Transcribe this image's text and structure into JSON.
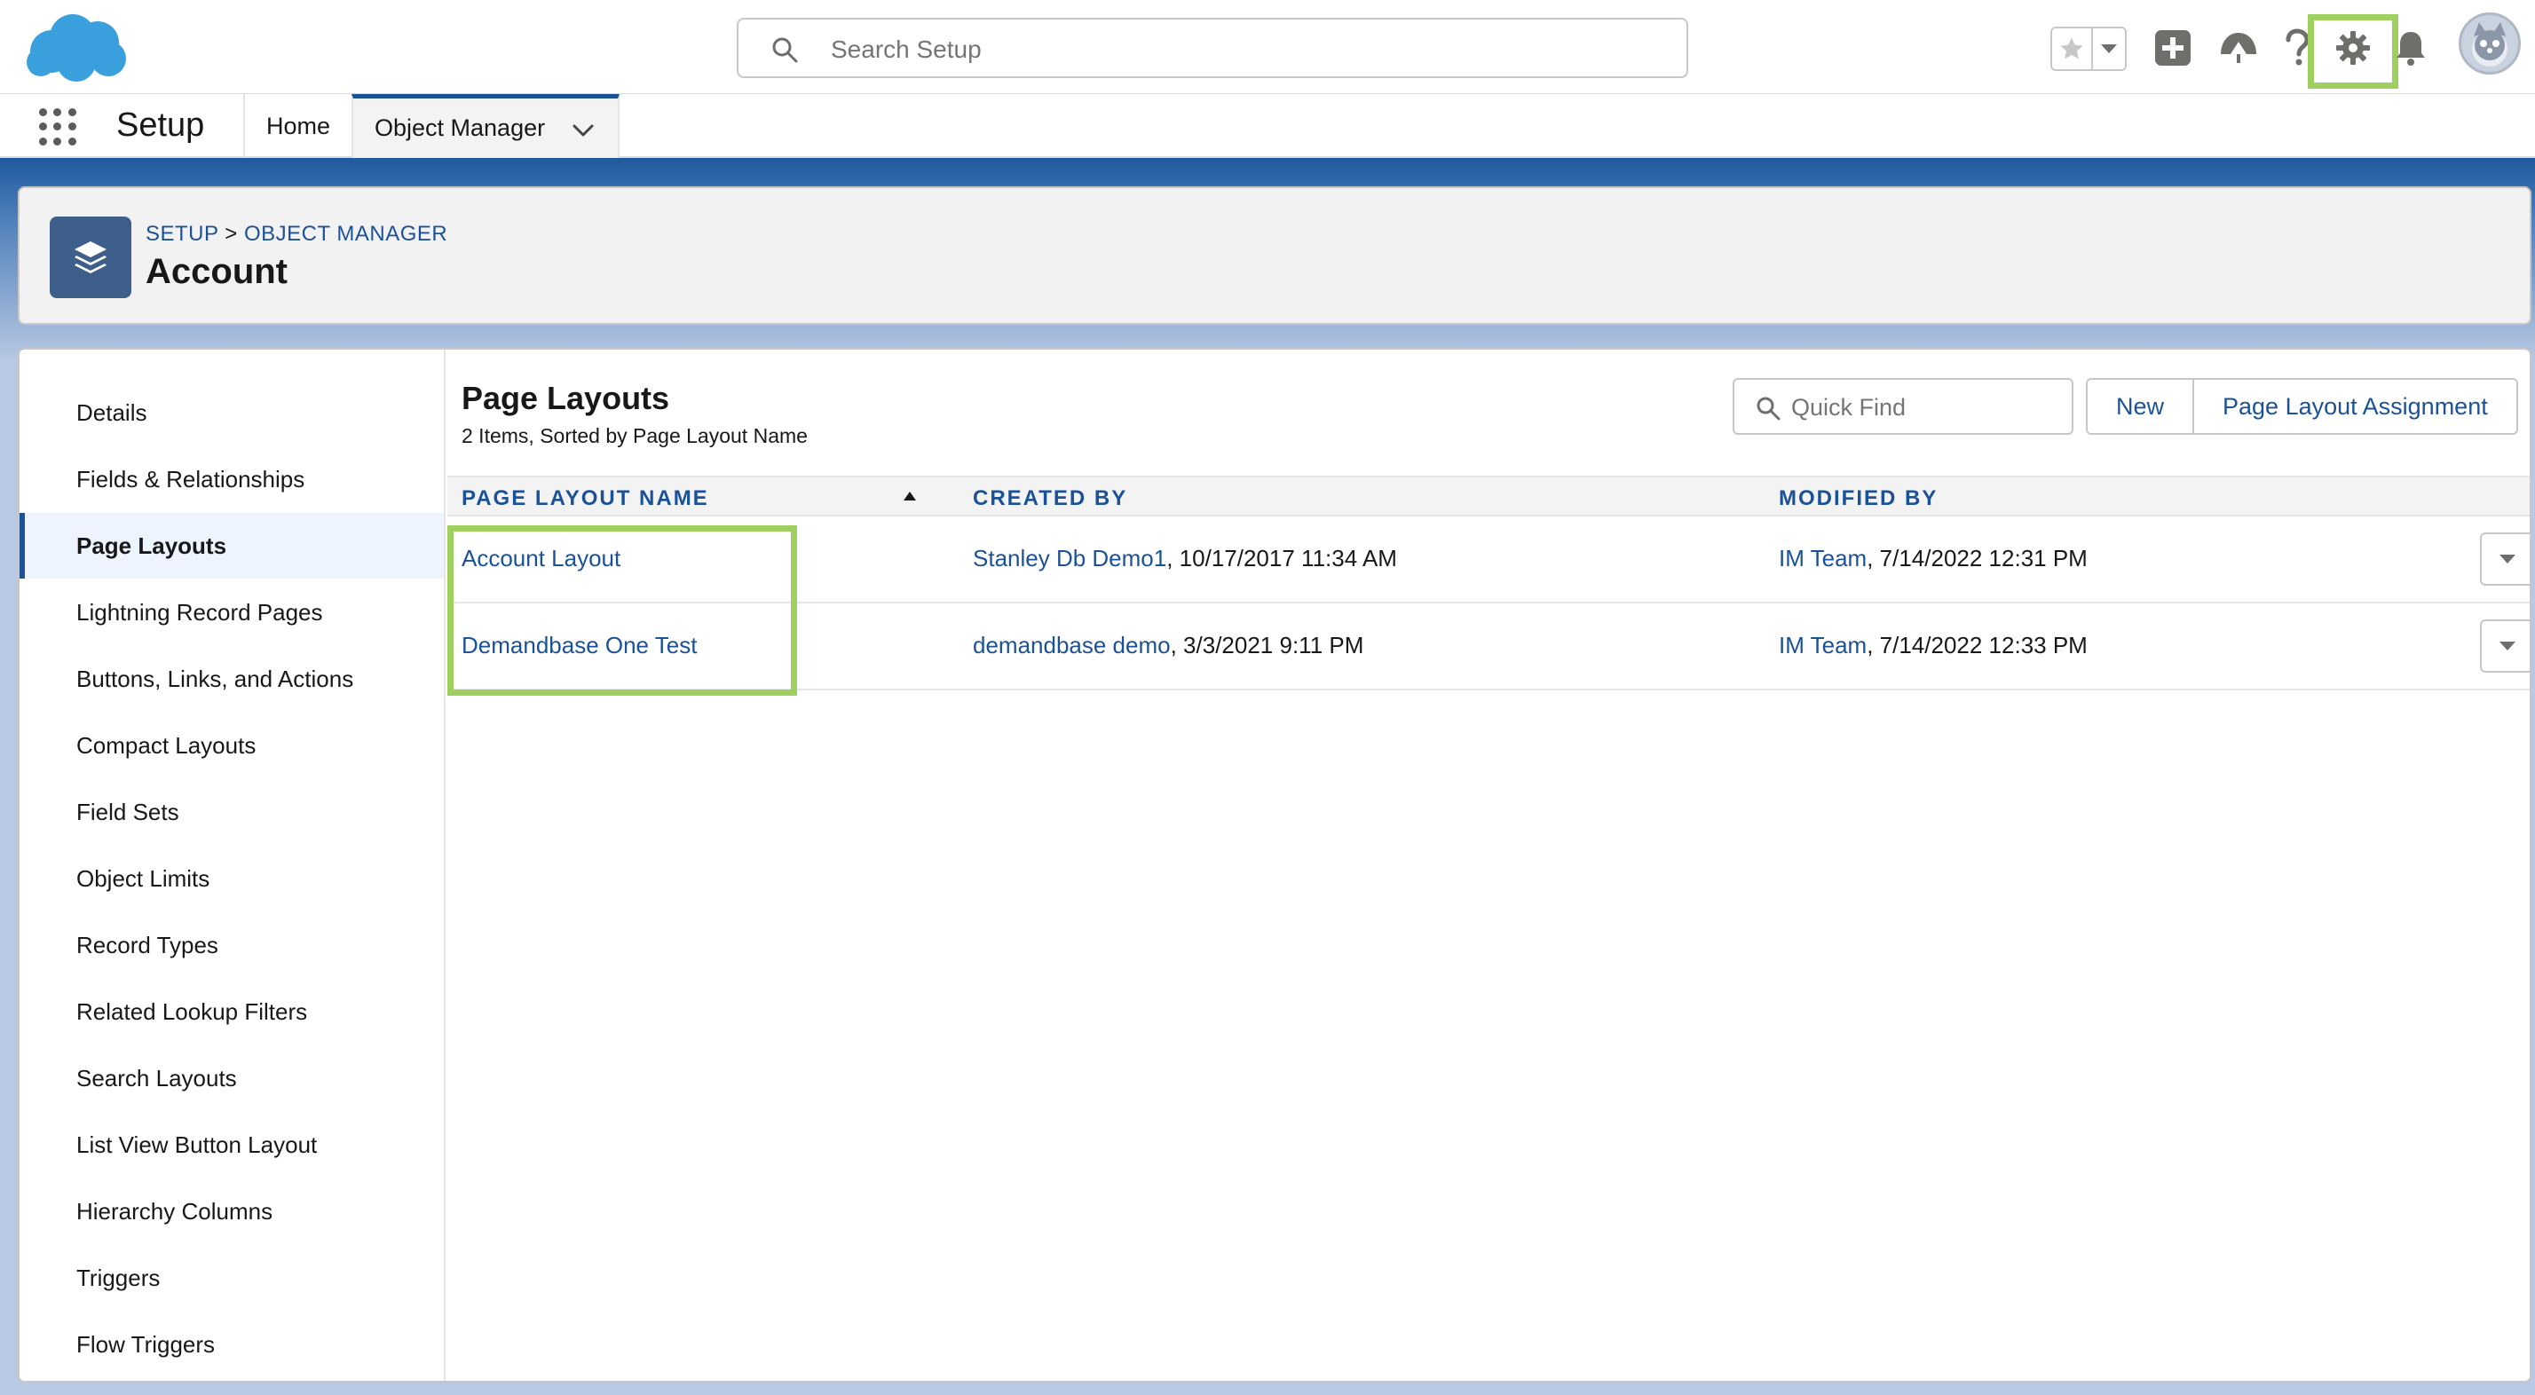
{
  "topbar": {
    "search_placeholder": "Search Setup",
    "icons": [
      "salesforce-cloud-logo",
      "search-icon",
      "star-icon",
      "chevron-down-icon",
      "add-icon",
      "trailhead-icon",
      "help-icon",
      "gear-icon",
      "bell-icon",
      "avatar"
    ],
    "highlight_color": "#9fcf5f"
  },
  "navbar": {
    "app_name": "Setup",
    "tabs": [
      {
        "label": "Home"
      },
      {
        "label": "Object Manager"
      }
    ]
  },
  "header": {
    "breadcrumb_setup": "SETUP",
    "breadcrumb_sep": ">",
    "breadcrumb_om": "OBJECT MANAGER",
    "title": "Account"
  },
  "sidebar": {
    "items": [
      {
        "label": "Details"
      },
      {
        "label": "Fields & Relationships"
      },
      {
        "label": "Page Layouts"
      },
      {
        "label": "Lightning Record Pages"
      },
      {
        "label": "Buttons, Links, and Actions"
      },
      {
        "label": "Compact Layouts"
      },
      {
        "label": "Field Sets"
      },
      {
        "label": "Object Limits"
      },
      {
        "label": "Record Types"
      },
      {
        "label": "Related Lookup Filters"
      },
      {
        "label": "Search Layouts"
      },
      {
        "label": "List View Button Layout"
      },
      {
        "label": "Hierarchy Columns"
      },
      {
        "label": "Triggers"
      },
      {
        "label": "Flow Triggers"
      }
    ],
    "active": "Page Layouts"
  },
  "main": {
    "title": "Page Layouts",
    "subtitle": "2 Items, Sorted by Page Layout Name",
    "quick_find_placeholder": "Quick Find",
    "new_label": "New",
    "assignment_label": "Page Layout Assignment",
    "columns": [
      "PAGE LAYOUT NAME",
      "CREATED BY",
      "MODIFIED BY"
    ],
    "rows": [
      {
        "name": "Account Layout",
        "created_by": "Stanley Db Demo1",
        "created_on": ", 10/17/2017 11:34 AM",
        "modified_by": "IM Team",
        "modified_on": ", 7/14/2022 12:31 PM"
      },
      {
        "name": "Demandbase One Test",
        "created_by": "demandbase demo",
        "created_on": ", 3/3/2021 9:11 PM",
        "modified_by": "IM Team",
        "modified_on": ", 7/14/2022 12:33 PM"
      }
    ]
  },
  "colors": {
    "link": "#1b5297",
    "brand_blue": "#1f5a9e",
    "highlight_green": "#9fcf5f"
  }
}
